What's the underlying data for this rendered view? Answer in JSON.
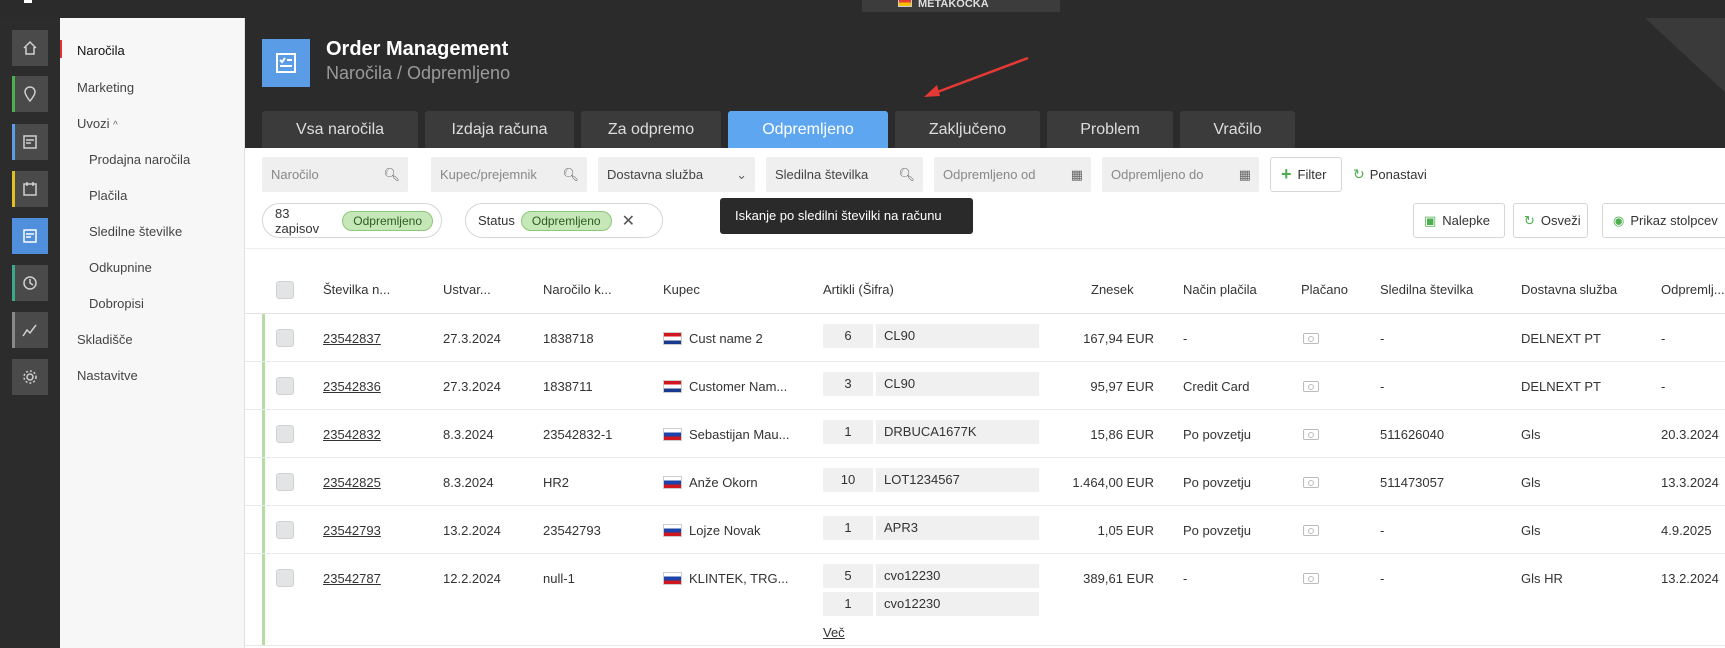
{
  "topbar": {
    "brand": "METAKOCKA"
  },
  "sidebar": {
    "items": [
      {
        "label": "Naročila"
      },
      {
        "label": "Marketing"
      },
      {
        "label": "Uvozi"
      },
      {
        "label": "Prodajna naročila"
      },
      {
        "label": "Plačila"
      },
      {
        "label": "Sledilne številke"
      },
      {
        "label": "Odkupnine"
      },
      {
        "label": "Dobropisi"
      },
      {
        "label": "Skladišče"
      },
      {
        "label": "Nastavitve"
      }
    ]
  },
  "header": {
    "title": "Order Management",
    "breadcrumb": "Naročila / Odpremljeno"
  },
  "tabs": [
    {
      "label": "Vsa naročila"
    },
    {
      "label": "Izdaja računa"
    },
    {
      "label": "Za odpremo"
    },
    {
      "label": "Odpremljeno"
    },
    {
      "label": "Zaključeno"
    },
    {
      "label": "Problem"
    },
    {
      "label": "Vračilo"
    }
  ],
  "filters": {
    "order": "Naročilo",
    "customer": "Kupec/prejemnik",
    "delivery": "Dostavna služba",
    "tracking": "Sledilna številka",
    "shipped_from": "Odpremljeno od",
    "shipped_to": "Odpremljeno do",
    "filter_btn": "Filter",
    "reset_btn": "Ponastavi"
  },
  "chips": {
    "count_text": "83 zapisov",
    "count_pill": "Odpremljeno",
    "status_label": "Status",
    "status_pill": "Odpremljeno"
  },
  "tooltip": "Iskanje po sledilni številki na računu",
  "actions": {
    "labels": "Nalepke",
    "refresh": "Osveži",
    "columns": "Prikaz stolpcev"
  },
  "table": {
    "headers": [
      "Številka n...",
      "Ustvar...",
      "Naročilo k...",
      "Kupec",
      "Artikli (Šifra)",
      "Znesek",
      "Način plačila",
      "Plačano",
      "Sledilna številka",
      "Dostavna služba",
      "Odpremlj..."
    ],
    "more_link": "Več",
    "rows": [
      {
        "num": "23542837",
        "created": "27.3.2024",
        "order": "1838718",
        "flag": "hr",
        "customer": "Cust name 2",
        "items": [
          {
            "qty": "6",
            "sku": "CL90"
          }
        ],
        "amount": "167,94 EUR",
        "payment": "-",
        "tracking": "-",
        "delivery": "DELNEXT PT",
        "shipped": "-"
      },
      {
        "num": "23542836",
        "created": "27.3.2024",
        "order": "1838711",
        "flag": "hr",
        "customer": "Customer Nam...",
        "items": [
          {
            "qty": "3",
            "sku": "CL90"
          }
        ],
        "amount": "95,97 EUR",
        "payment": "Credit Card",
        "tracking": "-",
        "delivery": "DELNEXT PT",
        "shipped": "-"
      },
      {
        "num": "23542832",
        "created": "8.3.2024",
        "order": "23542832-1",
        "flag": "si",
        "customer": "Sebastijan Mau...",
        "items": [
          {
            "qty": "1",
            "sku": "DRBUCA1677K"
          }
        ],
        "amount": "15,86 EUR",
        "payment": "Po povzetju",
        "tracking": "511626040",
        "delivery": "Gls",
        "shipped": "20.3.2024"
      },
      {
        "num": "23542825",
        "created": "8.3.2024",
        "order": "HR2",
        "flag": "si",
        "customer": "Anže Okorn",
        "items": [
          {
            "qty": "10",
            "sku": "LOT1234567"
          }
        ],
        "amount": "1.464,00 EUR",
        "payment": "Po povzetju",
        "tracking": "511473057",
        "delivery": "Gls",
        "shipped": "13.3.2024"
      },
      {
        "num": "23542793",
        "created": "13.2.2024",
        "order": "23542793",
        "flag": "si",
        "customer": "Lojze Novak",
        "items": [
          {
            "qty": "1",
            "sku": "APR3"
          }
        ],
        "amount": "1,05 EUR",
        "payment": "Po povzetju",
        "tracking": "-",
        "delivery": "Gls",
        "shipped": "4.9.2025"
      },
      {
        "num": "23542787",
        "created": "12.2.2024",
        "order": "null-1",
        "flag": "si",
        "customer": "KLINTEK, TRG...",
        "items": [
          {
            "qty": "5",
            "sku": "cvo12230"
          },
          {
            "qty": "1",
            "sku": "cvo12230"
          }
        ],
        "amount": "389,61 EUR",
        "payment": "-",
        "tracking": "-",
        "delivery": "Gls HR",
        "shipped": "13.2.2024"
      }
    ]
  }
}
